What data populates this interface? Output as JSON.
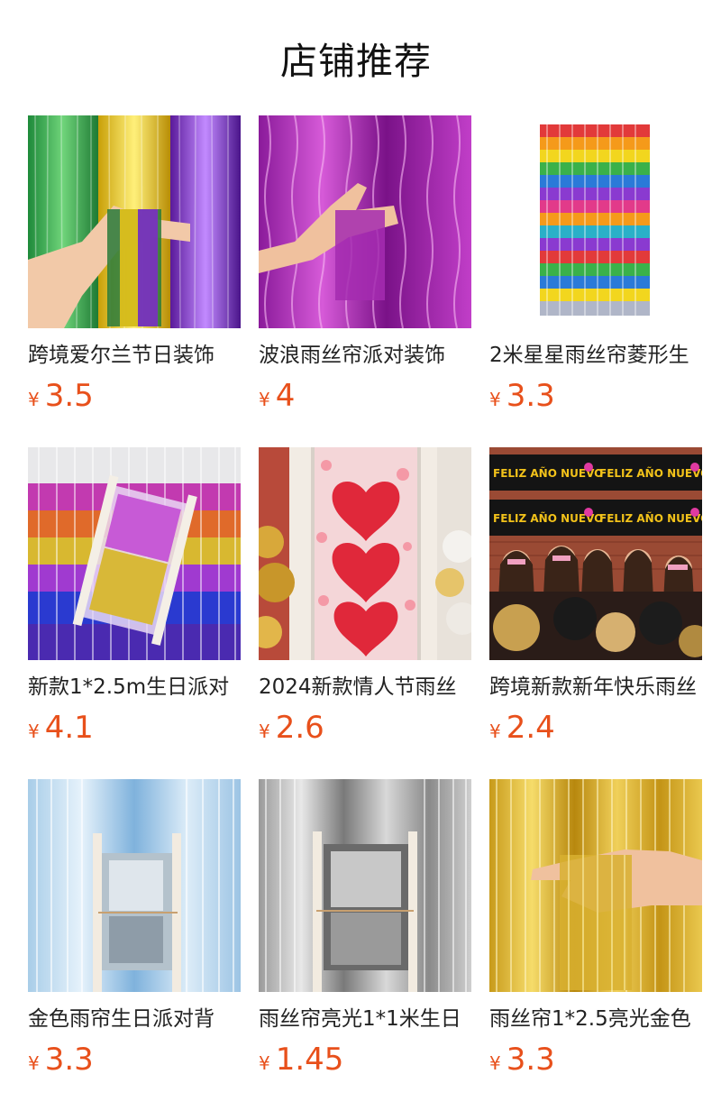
{
  "section": {
    "title": "店铺推荐"
  },
  "currency_symbol": "¥",
  "products": [
    {
      "name": "跨境爱尔兰节日装饰",
      "price": "3.5"
    },
    {
      "name": "波浪雨丝帘派对装饰",
      "price": "4"
    },
    {
      "name": "2米星星雨丝帘菱形生",
      "price": "3.3"
    },
    {
      "name": "新款1*2.5m生日派对",
      "price": "4.1"
    },
    {
      "name": "2024新款情人节雨丝",
      "price": "2.6"
    },
    {
      "name": "跨境新款新年快乐雨丝",
      "price": "2.4"
    },
    {
      "name": "金色雨帘生日派对背",
      "price": "3.3"
    },
    {
      "name": "雨丝帘亮光1*1米生日",
      "price": "1.45"
    },
    {
      "name": "雨丝帘1*2.5亮光金色",
      "price": "3.3"
    }
  ],
  "banner_text": "FELIZ AÑO NUEVO"
}
